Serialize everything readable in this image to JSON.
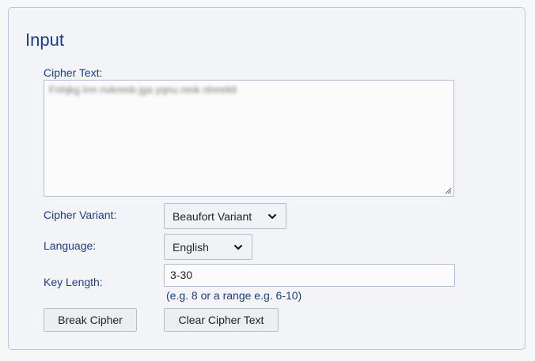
{
  "panel": {
    "title": "Input"
  },
  "cipher": {
    "label": "Cipher Text:",
    "value": "Fnhjkg lrm nvknmb jga yqnu nmk nhmrklt"
  },
  "variant": {
    "label": "Cipher Variant:",
    "selected": "Beaufort Variant"
  },
  "language": {
    "label": "Language:",
    "selected": "English"
  },
  "key_length": {
    "label": "Key Length:",
    "value": "3-30",
    "hint": "(e.g. 8 or a range e.g. 6-10)"
  },
  "buttons": {
    "break": "Break Cipher",
    "clear": "Clear Cipher Text"
  },
  "icons": {
    "dropdown": "chevron-down-icon",
    "resize": "resize-grip-icon"
  },
  "colors": {
    "label_blue": "#1f3b86",
    "border_blue": "#aebed8",
    "panel_bg": "#f3f4f7"
  }
}
